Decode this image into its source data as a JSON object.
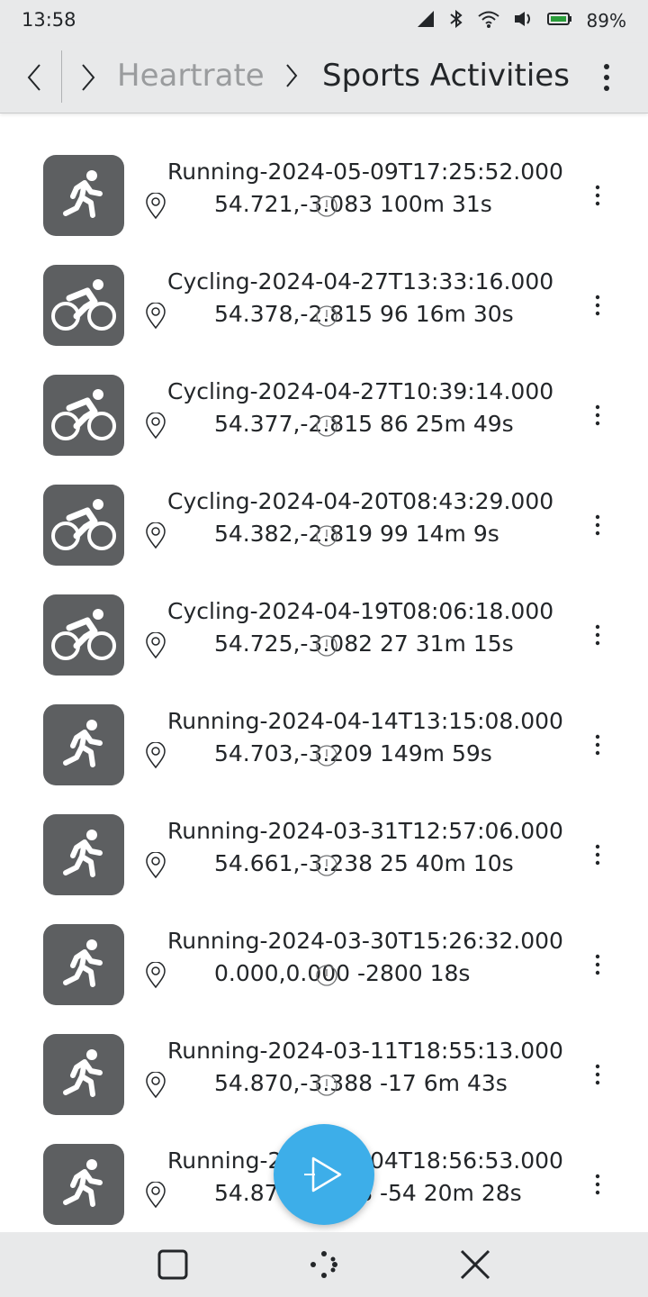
{
  "status_bar": {
    "time": "13:58",
    "battery_percent": "89%",
    "icons": [
      "signal-icon",
      "bluetooth-icon",
      "wifi-icon",
      "vibrate-icon",
      "battery-icon"
    ]
  },
  "toolbar": {
    "breadcrumb_parent": "Heartrate",
    "breadcrumb_current": "Sports Activities"
  },
  "activities": [
    {
      "type": "running",
      "title": "Running-2024-05-09T17:25:52.000",
      "subtitle": "54.721,-3.083  100m 31s"
    },
    {
      "type": "cycling",
      "title": "Cycling-2024-04-27T13:33:16.000",
      "subtitle": "54.378,-2.815  96 16m 30s"
    },
    {
      "type": "cycling",
      "title": "Cycling-2024-04-27T10:39:14.000",
      "subtitle": "54.377,-2.815  86 25m 49s"
    },
    {
      "type": "cycling",
      "title": "Cycling-2024-04-20T08:43:29.000",
      "subtitle": "54.382,-2.819  99 14m 9s"
    },
    {
      "type": "cycling",
      "title": "Cycling-2024-04-19T08:06:18.000",
      "subtitle": "54.725,-3.082  27 31m 15s"
    },
    {
      "type": "running",
      "title": "Running-2024-04-14T13:15:08.000",
      "subtitle": "54.703,-3.209  149m 59s"
    },
    {
      "type": "running",
      "title": "Running-2024-03-31T12:57:06.000",
      "subtitle": "54.661,-3.238  25 40m 10s"
    },
    {
      "type": "running",
      "title": "Running-2024-03-30T15:26:32.000",
      "subtitle": "0.000,0.000  -2800 18s"
    },
    {
      "type": "running",
      "title": "Running-2024-03-11T18:55:13.000",
      "subtitle": "54.870,-3.388  -17 6m 43s"
    },
    {
      "type": "running",
      "title": "Running-2024-03-04T18:56:53.000",
      "subtitle": "54.870,-3.388  -54 20m 28s"
    }
  ],
  "colors": {
    "accent": "#3daee9",
    "tile_bg": "#5d5f61",
    "bar_bg": "#e8e9ea"
  }
}
